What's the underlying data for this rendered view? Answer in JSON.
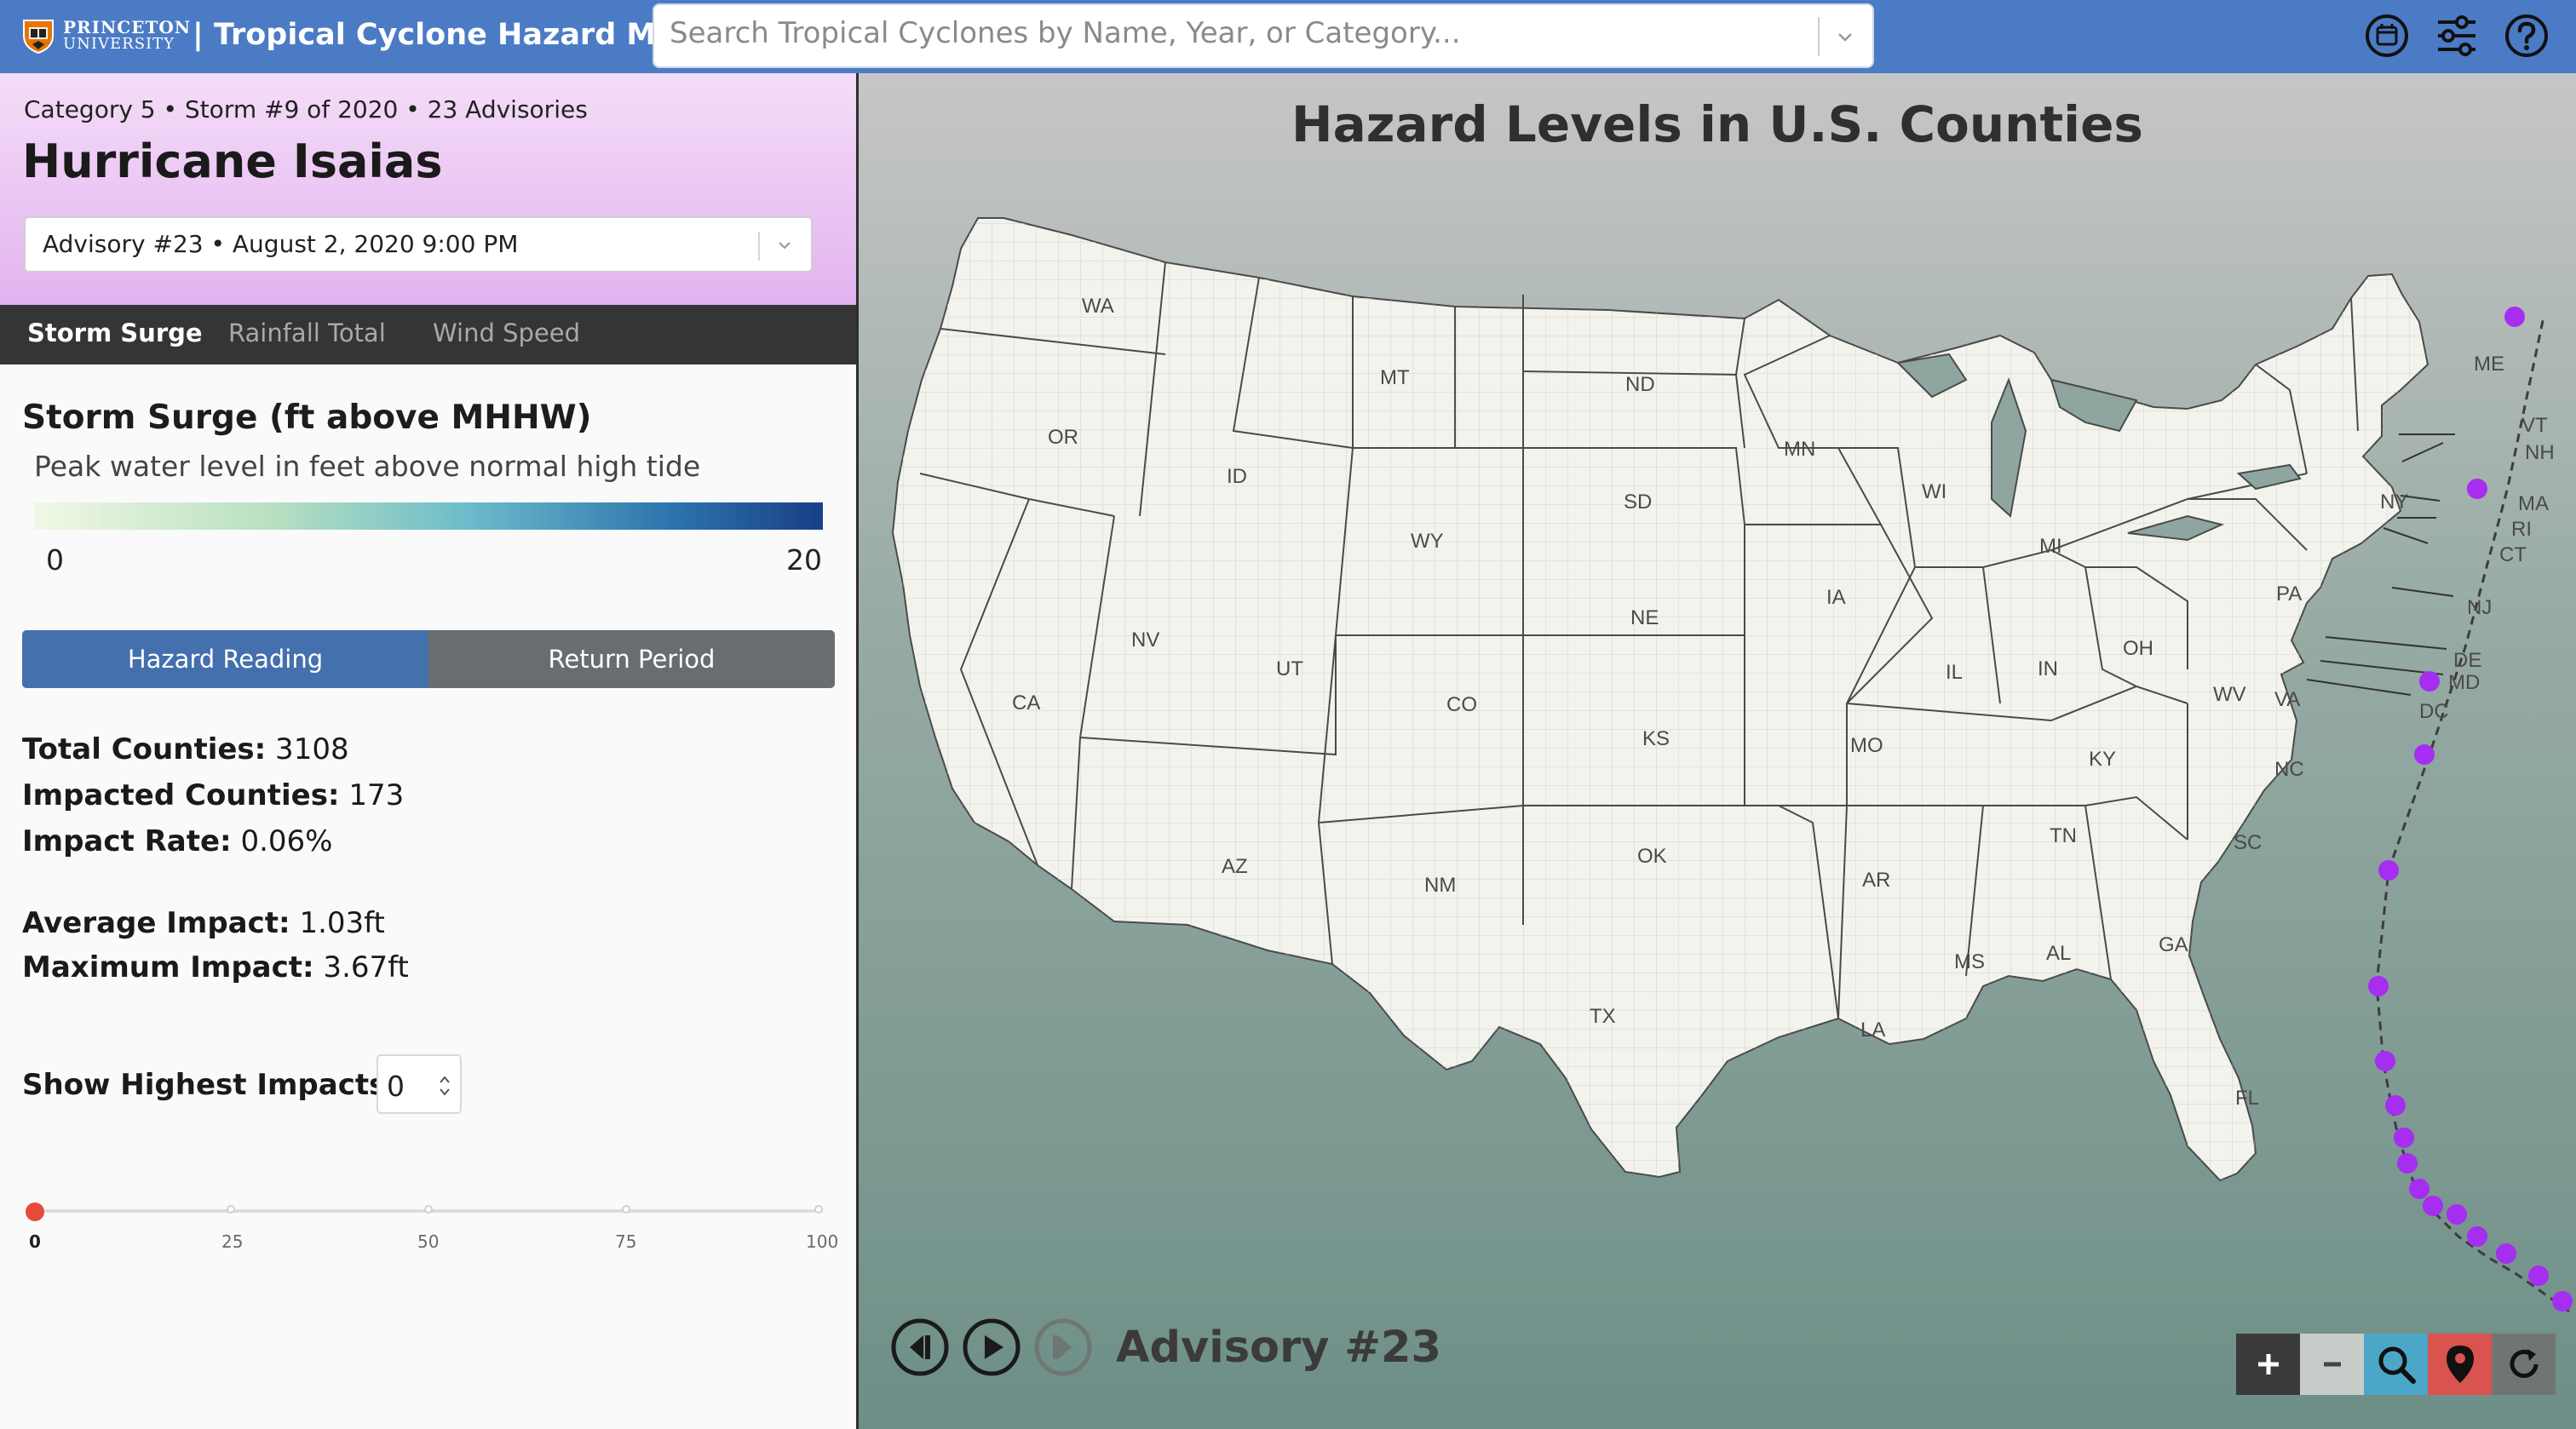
{
  "header": {
    "logo_line1": "PRINCETON",
    "logo_line2": "UNIVERSITY",
    "title": "| Tropical Cyclone Hazard Map",
    "search_placeholder": "Search Tropical Cyclones by Name, Year, or Category...",
    "icons": [
      "calendar-icon",
      "sliders-icon",
      "help-icon"
    ]
  },
  "storm": {
    "meta": "Category 5 • Storm #9 of 2020 • 23 Advisories",
    "name": "Hurricane Isaias",
    "advisory_selected": "Advisory #23 • August 2, 2020 9:00 PM"
  },
  "tabs": [
    {
      "label": "Storm Surge",
      "active": true
    },
    {
      "label": "Rainfall Total",
      "active": false
    },
    {
      "label": "Wind Speed",
      "active": false
    }
  ],
  "hazard": {
    "title": "Storm Surge (ft above MHHW)",
    "description": "Peak water level in feet above normal high tide",
    "legend_min": "0",
    "legend_max": "20",
    "legend_colors": [
      "#f1f8e6",
      "#b8e0c0",
      "#6cbccb",
      "#2d76ae",
      "#1a3f86"
    ],
    "toggle_left": "Hazard Reading",
    "toggle_right": "Return Period"
  },
  "stats": {
    "total_label": "Total Counties:",
    "total_value": " 3108",
    "impacted_label": "Impacted Counties:",
    "impacted_value": " 173",
    "rate_label": "Impact Rate:",
    "rate_value": " 0.06%",
    "avg_label": "Average Impact:",
    "avg_value": " 1.03ft",
    "max_label": "Maximum Impact:",
    "max_value": " 3.67ft"
  },
  "highest": {
    "label": "Show Highest Impacts:",
    "value": "0",
    "slider_labels": [
      "0",
      "25",
      "50",
      "75",
      "100"
    ],
    "slider_value": 0
  },
  "map": {
    "title": "Hazard Levels in U.S. Counties",
    "advisory_label": "Advisory #23",
    "states": [
      "WA",
      "OR",
      "CA",
      "ID",
      "NV",
      "MT",
      "WY",
      "UT",
      "AZ",
      "CO",
      "NM",
      "ND",
      "SD",
      "NE",
      "KS",
      "OK",
      "TX",
      "MN",
      "IA",
      "MO",
      "AR",
      "LA",
      "WI",
      "IL",
      "MI",
      "IN",
      "OH",
      "KY",
      "TN",
      "MS",
      "AL",
      "GA",
      "FL",
      "SC",
      "NC",
      "VA",
      "WV",
      "PA",
      "NY",
      "ME",
      "VT",
      "NH",
      "MA",
      "RI",
      "CT",
      "NJ",
      "DE",
      "MD",
      "DC"
    ],
    "track_color": "#a52ef0",
    "tools": [
      "zoom-in",
      "zoom-out",
      "search",
      "locate",
      "reset"
    ]
  }
}
